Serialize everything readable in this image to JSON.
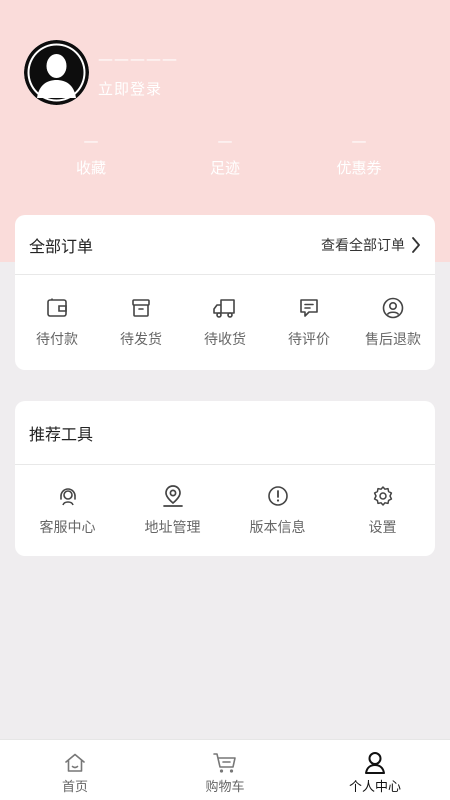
{
  "profile": {
    "username": "—————",
    "login_label": "立即登录"
  },
  "stats": [
    {
      "value": "—",
      "label": "收藏"
    },
    {
      "value": "—",
      "label": "足迹"
    },
    {
      "value": "—",
      "label": "优惠券"
    }
  ],
  "orders": {
    "title": "全部订单",
    "view_all": "查看全部订单",
    "items": [
      {
        "label": "待付款",
        "icon": "wallet-icon"
      },
      {
        "label": "待发货",
        "icon": "box-icon"
      },
      {
        "label": "待收货",
        "icon": "truck-icon"
      },
      {
        "label": "待评价",
        "icon": "comment-icon"
      },
      {
        "label": "售后退款",
        "icon": "user-circle-icon"
      }
    ]
  },
  "tools": {
    "title": "推荐工具",
    "items": [
      {
        "label": "客服中心",
        "icon": "headset-icon"
      },
      {
        "label": "地址管理",
        "icon": "map-pin-icon"
      },
      {
        "label": "版本信息",
        "icon": "info-icon"
      },
      {
        "label": "设置",
        "icon": "gear-icon"
      }
    ]
  },
  "tabbar": {
    "items": [
      {
        "label": "首页",
        "icon": "home-icon",
        "active": false
      },
      {
        "label": "购物车",
        "icon": "cart-icon",
        "active": false
      },
      {
        "label": "个人中心",
        "icon": "person-icon",
        "active": true
      }
    ]
  },
  "colors": {
    "header_bg": "#fadcda",
    "page_bg": "#efedef",
    "card_bg": "#ffffff",
    "text_muted": "#666666",
    "tab_active": "#111111"
  }
}
